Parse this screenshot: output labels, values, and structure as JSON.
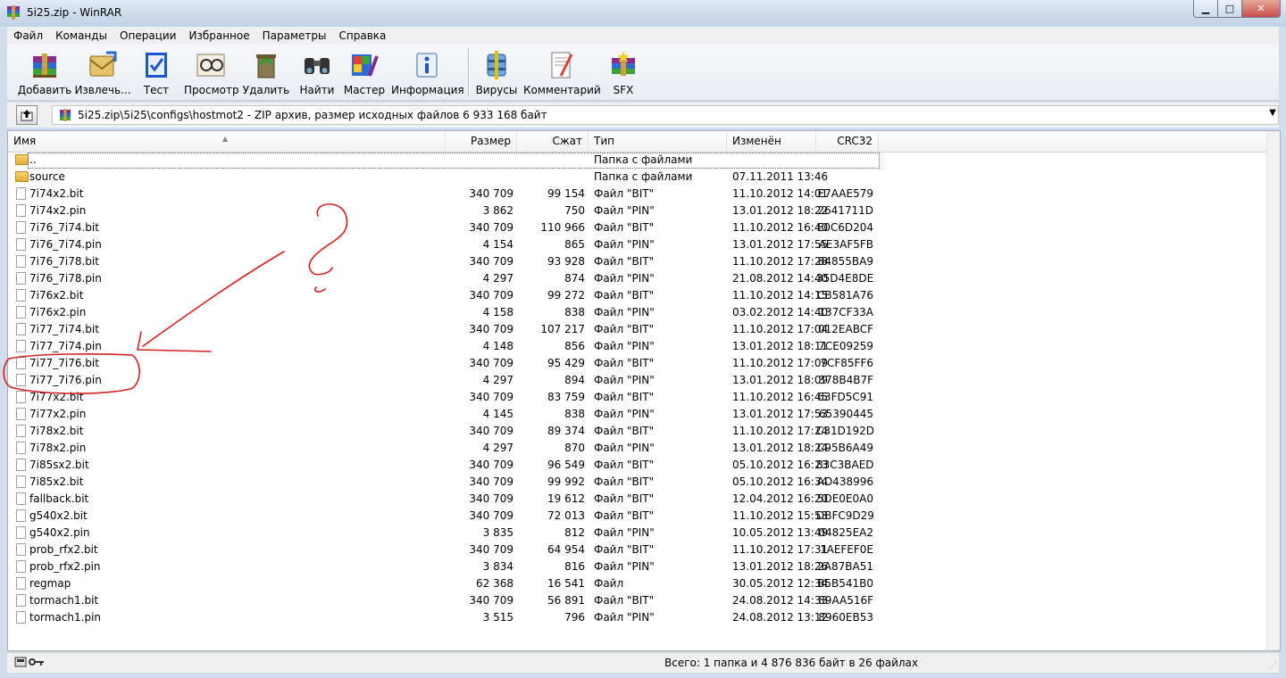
{
  "window": {
    "title": "5i25.zip - WinRAR",
    "controls": {
      "minimize": "▁",
      "maximize": "□",
      "close": "✕"
    }
  },
  "menu": [
    "Файл",
    "Команды",
    "Операции",
    "Избранное",
    "Параметры",
    "Справка"
  ],
  "toolbar": {
    "buttons": [
      {
        "label": "Добавить",
        "icon": "add-archive-icon"
      },
      {
        "label": "Извлечь...",
        "icon": "extract-icon"
      },
      {
        "label": "Тест",
        "icon": "test-icon"
      },
      {
        "label": "Просмотр",
        "icon": "view-icon"
      },
      {
        "label": "Удалить",
        "icon": "delete-icon"
      },
      {
        "label": "Найти",
        "icon": "find-icon"
      },
      {
        "label": "Мастер",
        "icon": "wizard-icon"
      },
      {
        "label": "Информация",
        "icon": "info-icon"
      },
      {
        "label": "Вирусы",
        "icon": "virus-scan-icon"
      },
      {
        "label": "Комментарий",
        "icon": "comment-icon"
      },
      {
        "label": "SFX",
        "icon": "sfx-icon"
      }
    ]
  },
  "address": {
    "path": "5i25.zip\\5i25\\configs\\hostmot2 - ZIP архив, размер исходных файлов 6 933 168 байт"
  },
  "columns": {
    "name": "Имя",
    "size": "Размер",
    "packed": "Сжат",
    "type": "Тип",
    "modified": "Изменён",
    "crc": "CRC32"
  },
  "files": [
    {
      "name": "..",
      "size": "",
      "packed": "",
      "type": "Папка с файлами",
      "modified": "",
      "crc": "",
      "kind": "folder"
    },
    {
      "name": "source",
      "size": "",
      "packed": "",
      "type": "Папка с файлами",
      "modified": "07.11.2011 13:46",
      "crc": "",
      "kind": "folder"
    },
    {
      "name": "7i74x2.bit",
      "size": "340 709",
      "packed": "99 154",
      "type": "Файл \"BIT\"",
      "modified": "11.10.2012 14:01",
      "crc": "E7AAE579",
      "kind": "file"
    },
    {
      "name": "7i74x2.pin",
      "size": "3 862",
      "packed": "750",
      "type": "Файл \"PIN\"",
      "modified": "13.01.2012 18:22",
      "crc": "2641711D",
      "kind": "file"
    },
    {
      "name": "7i76_7i74.bit",
      "size": "340 709",
      "packed": "110 966",
      "type": "Файл \"BIT\"",
      "modified": "11.10.2012 16:40",
      "crc": "E0C6D204",
      "kind": "file"
    },
    {
      "name": "7i76_7i74.pin",
      "size": "4 154",
      "packed": "865",
      "type": "Файл \"PIN\"",
      "modified": "13.01.2012 17:55",
      "crc": "AE3AF5FB",
      "kind": "file"
    },
    {
      "name": "7i76_7i78.bit",
      "size": "340 709",
      "packed": "93 928",
      "type": "Файл \"BIT\"",
      "modified": "11.10.2012 17:28",
      "crc": "84855BA9",
      "kind": "file"
    },
    {
      "name": "7i76_7i78.pin",
      "size": "4 297",
      "packed": "874",
      "type": "Файл \"PIN\"",
      "modified": "21.08.2012 14:40",
      "crc": "35D4E8DE",
      "kind": "file"
    },
    {
      "name": "7i76x2.bit",
      "size": "340 709",
      "packed": "99 272",
      "type": "Файл \"BIT\"",
      "modified": "11.10.2012 14:15",
      "crc": "CB581A76",
      "kind": "file"
    },
    {
      "name": "7i76x2.pin",
      "size": "4 158",
      "packed": "838",
      "type": "Файл \"PIN\"",
      "modified": "03.02.2012 14:40",
      "crc": "137CF33A",
      "kind": "file"
    },
    {
      "name": "7i77_7i74.bit",
      "size": "340 709",
      "packed": "107 217",
      "type": "Файл \"BIT\"",
      "modified": "11.10.2012 17:04",
      "crc": "012EABCF",
      "kind": "file"
    },
    {
      "name": "7i77_7i74.pin",
      "size": "4 148",
      "packed": "856",
      "type": "Файл \"PIN\"",
      "modified": "13.01.2012 18:11",
      "crc": "7CE09259",
      "kind": "file"
    },
    {
      "name": "7i77_7i76.bit",
      "size": "340 709",
      "packed": "95 429",
      "type": "Файл \"BIT\"",
      "modified": "11.10.2012 17:09",
      "crc": "7CF85FF6",
      "kind": "file"
    },
    {
      "name": "7i77_7i76.pin",
      "size": "4 297",
      "packed": "894",
      "type": "Файл \"PIN\"",
      "modified": "13.01.2012 18:09",
      "crc": "378B4B7F",
      "kind": "file"
    },
    {
      "name": "7i77x2.bit",
      "size": "340 709",
      "packed": "83 759",
      "type": "Файл \"BIT\"",
      "modified": "11.10.2012 16:45",
      "crc": "63FD5C91",
      "kind": "file"
    },
    {
      "name": "7i77x2.pin",
      "size": "4 145",
      "packed": "838",
      "type": "Файл \"PIN\"",
      "modified": "13.01.2012 17:53",
      "crc": "65390445",
      "kind": "file"
    },
    {
      "name": "7i78x2.bit",
      "size": "340 709",
      "packed": "89 374",
      "type": "Файл \"BIT\"",
      "modified": "11.10.2012 17:24",
      "crc": "C31D192D",
      "kind": "file"
    },
    {
      "name": "7i78x2.pin",
      "size": "4 297",
      "packed": "870",
      "type": "Файл \"PIN\"",
      "modified": "13.01.2012 18:24",
      "crc": "C95B6A49",
      "kind": "file"
    },
    {
      "name": "7i85sx2.bit",
      "size": "340 709",
      "packed": "96 549",
      "type": "Файл \"BIT\"",
      "modified": "05.10.2012 16:23",
      "crc": "83C3BAED",
      "kind": "file"
    },
    {
      "name": "7i85x2.bit",
      "size": "340 709",
      "packed": "99 992",
      "type": "Файл \"BIT\"",
      "modified": "05.10.2012 16:34",
      "crc": "AD438996",
      "kind": "file"
    },
    {
      "name": "fallback.bit",
      "size": "340 709",
      "packed": "19 612",
      "type": "Файл \"BIT\"",
      "modified": "12.04.2012 16:20",
      "crc": "5DE0E0A0",
      "kind": "file"
    },
    {
      "name": "g540x2.bit",
      "size": "340 709",
      "packed": "72 013",
      "type": "Файл \"BIT\"",
      "modified": "11.10.2012 15:53",
      "crc": "DBFC9D29",
      "kind": "file"
    },
    {
      "name": "g540x2.pin",
      "size": "3 835",
      "packed": "812",
      "type": "Файл \"PIN\"",
      "modified": "10.05.2012 13:49",
      "crc": "04825EA2",
      "kind": "file"
    },
    {
      "name": "prob_rfx2.bit",
      "size": "340 709",
      "packed": "64 954",
      "type": "Файл \"BIT\"",
      "modified": "11.10.2012 17:31",
      "crc": "1AEFEF0E",
      "kind": "file"
    },
    {
      "name": "prob_rfx2.pin",
      "size": "3 834",
      "packed": "816",
      "type": "Файл \"PIN\"",
      "modified": "13.01.2012 18:26",
      "crc": "2A87BA51",
      "kind": "file"
    },
    {
      "name": "regmap",
      "size": "62 368",
      "packed": "16 541",
      "type": "Файл",
      "modified": "30.05.2012 12:34",
      "crc": "B5B541B0",
      "kind": "file"
    },
    {
      "name": "tormach1.bit",
      "size": "340 709",
      "packed": "56 891",
      "type": "Файл \"BIT\"",
      "modified": "24.08.2012 14:33",
      "crc": "89AA516F",
      "kind": "file"
    },
    {
      "name": "tormach1.pin",
      "size": "3 515",
      "packed": "796",
      "type": "Файл \"PIN\"",
      "modified": "24.08.2012 13:12",
      "crc": "8960EB53",
      "kind": "file"
    }
  ],
  "status": {
    "text": "Всего: 1 папка и 4 876 836 байт в 26 файлах"
  },
  "colors": {
    "annotation": "#d42020",
    "window_frame": "#cfdcec"
  }
}
